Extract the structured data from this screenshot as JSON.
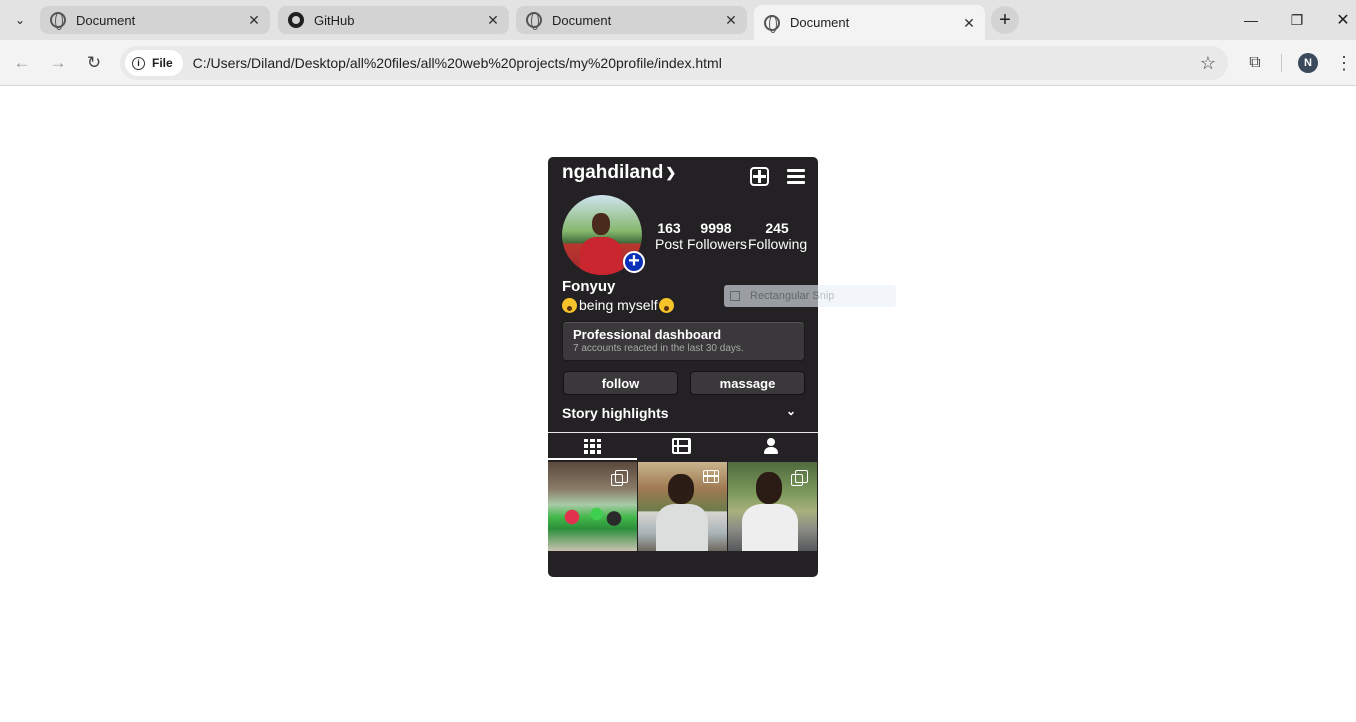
{
  "browser": {
    "tabs": [
      {
        "title": "Document",
        "favicon": "globe-icon",
        "active": false
      },
      {
        "title": "GitHub",
        "favicon": "github-icon",
        "active": false
      },
      {
        "title": "Document",
        "favicon": "globe-icon",
        "active": false
      },
      {
        "title": "Document",
        "favicon": "globe-icon",
        "active": true
      }
    ],
    "new_tab_symbol": "+",
    "close_symbol": "✕",
    "chip_label": "File",
    "url": "C:/Users/Diland/Desktop/all%20files/all%20web%20projects/my%20profile/index.html",
    "profile_initial": "N"
  },
  "profile": {
    "username": "ngahdiland",
    "display_name": "Fonyuy",
    "bio": "being myself",
    "stats": [
      {
        "value": "163",
        "label": "Post"
      },
      {
        "value": "9998",
        "label": "Followers"
      },
      {
        "value": "245",
        "label": "Following"
      }
    ],
    "dashboard": {
      "title": "Professional dashboard",
      "subtitle": "7 accounts reacted in the last 30 days."
    },
    "buttons": {
      "follow": "follow",
      "message": "massage"
    },
    "story_highlights": "Story highlights",
    "grid_tabs": [
      {
        "icon": "grid-icon",
        "active": true
      },
      {
        "icon": "reels-icon",
        "active": false
      },
      {
        "icon": "tagged-user-icon",
        "active": false
      }
    ],
    "posts": [
      {
        "badge": "multiple-photos-icon"
      },
      {
        "badge": "reel-icon"
      },
      {
        "badge": "multiple-photos-icon"
      }
    ]
  },
  "overlay": {
    "ghost_label": "Rectangular Snip"
  },
  "colors": {
    "card_bg": "#232123",
    "button_bg": "#3a383a",
    "add_story_badge": "#0a2fb8"
  }
}
